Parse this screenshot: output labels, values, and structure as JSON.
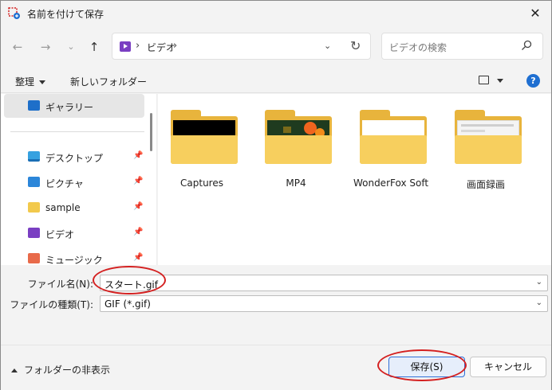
{
  "window": {
    "title": "名前を付けて保存",
    "close_label": "✕"
  },
  "nav": {
    "back_icon": "arrow-left",
    "forward_icon": "arrow-right",
    "recent_icon": "chevron-down",
    "up_icon": "arrow-up",
    "breadcrumb": "ビデオ",
    "search_placeholder": "ビデオの検索"
  },
  "toolbar": {
    "organize_label": "整理",
    "new_folder_label": "新しいフォルダー",
    "help_label": "?"
  },
  "sidebar": {
    "items": [
      {
        "label": "ギャラリー",
        "icon": "gallery-icon",
        "pinned": false,
        "selected": true
      },
      {
        "label": "デスクトップ",
        "icon": "desktop-icon",
        "pinned": true
      },
      {
        "label": "ピクチャ",
        "icon": "pictures-icon",
        "pinned": true
      },
      {
        "label": "sample",
        "icon": "folder-icon",
        "pinned": true
      },
      {
        "label": "ビデオ",
        "icon": "video-icon",
        "pinned": true
      },
      {
        "label": "ミュージック",
        "icon": "music-icon",
        "pinned": true
      }
    ]
  },
  "folders": [
    {
      "name": "Captures",
      "thumb": "black"
    },
    {
      "name": "MP4",
      "thumb": "flower"
    },
    {
      "name": "WonderFox Soft",
      "thumb": "empty"
    },
    {
      "name": "画面録画",
      "thumb": "screen"
    }
  ],
  "fields": {
    "filename_label": "ファイル名(N):",
    "filename_value": "スタート.gif",
    "filetype_label": "ファイルの種類(T):",
    "filetype_value": "GIF (*.gif)"
  },
  "footer": {
    "hide_folders_label": "フォルダーの非表示",
    "save_label": "保存(S)",
    "cancel_label": "キャンセル"
  },
  "colors": {
    "accent": "#2f6fd6",
    "annotation": "#d42020",
    "folder": "#f7cf5e"
  }
}
